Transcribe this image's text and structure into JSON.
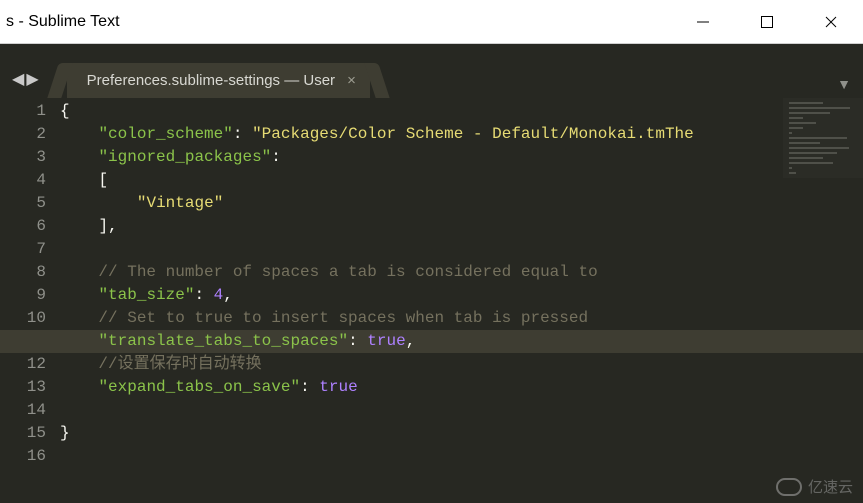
{
  "window": {
    "title_fragment": "s - Sublime Text"
  },
  "tab": {
    "label": "Preferences.sublime-settings — User"
  },
  "code": {
    "lines": [
      "{",
      "    \"color_scheme\": \"Packages/Color Scheme - Default/Monokai.tmThe",
      "    \"ignored_packages\":",
      "    [",
      "        \"Vintage\"",
      "    ],",
      "",
      "    // The number of spaces a tab is considered equal to",
      "    \"tab_size\": 4,",
      "    // Set to true to insert spaces when tab is pressed",
      "    \"translate_tabs_to_spaces\": true,",
      "    //设置保存时自动转换",
      "    \"expand_tabs_on_save\": true",
      "",
      "}",
      ""
    ],
    "highlighted_line": 11,
    "line_count": 16
  },
  "settings_values": {
    "color_scheme": "Packages/Color Scheme - Default/Monokai.tmTheme",
    "ignored_packages": [
      "Vintage"
    ],
    "tab_size": 4,
    "translate_tabs_to_spaces": true,
    "expand_tabs_on_save": true
  },
  "watermark": {
    "text": "亿速云"
  }
}
